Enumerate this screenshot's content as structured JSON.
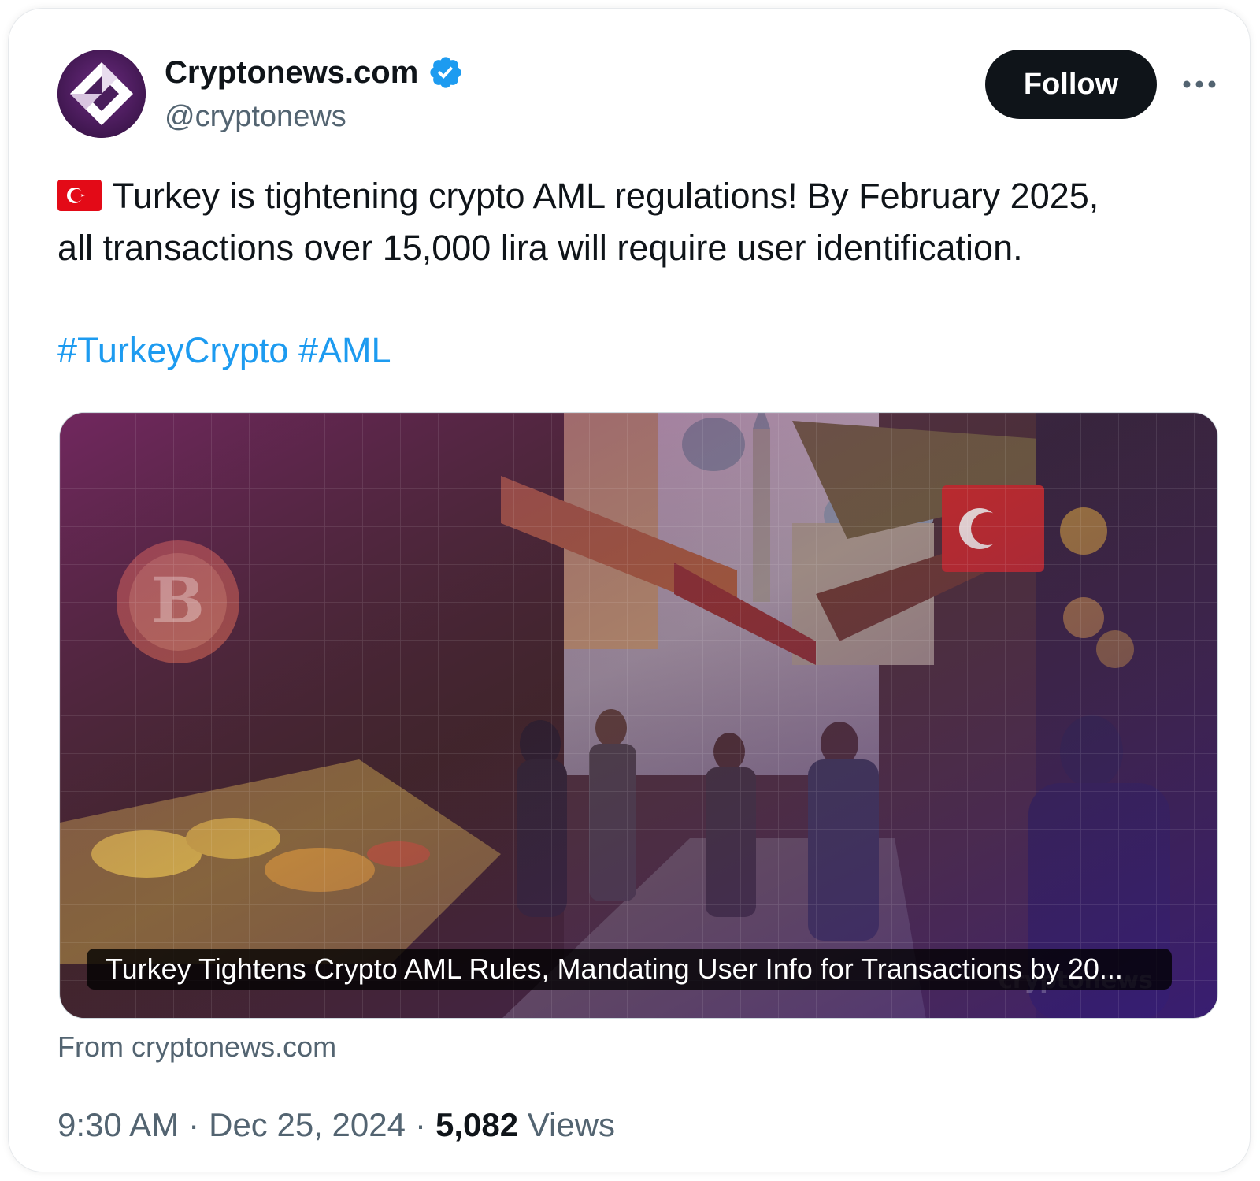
{
  "account": {
    "display_name": "Cryptonews.com",
    "handle": "@cryptonews",
    "verified": true,
    "avatar_icon": "cryptonews-logo"
  },
  "actions": {
    "follow_label": "Follow",
    "more_icon": "ellipsis-icon"
  },
  "tweet": {
    "flag_icon": "turkey-flag-emoji",
    "text_line1": "Turkey is tightening crypto AML regulations! By February 2025,",
    "text_line2": "all transactions over 15,000 lira will require user identification.",
    "hashtags": [
      "#TurkeyCrypto",
      "#AML"
    ]
  },
  "media_card": {
    "title": "Turkey Tightens Crypto AML Rules, Mandating User Info for Transactions by 20...",
    "source": "From cryptonews.com",
    "watermark": "cryptonews"
  },
  "meta": {
    "time": "9:30 AM",
    "date": "Dec 25, 2024",
    "views_count": "5,082",
    "views_label": "Views",
    "separator": "·"
  },
  "colors": {
    "text_primary": "#0f1419",
    "text_secondary": "#536471",
    "link": "#1d9bf0",
    "verified_badge": "#1d9bf0",
    "follow_button_bg": "#0f1419",
    "avatar_bg": "#4a1e5c"
  }
}
